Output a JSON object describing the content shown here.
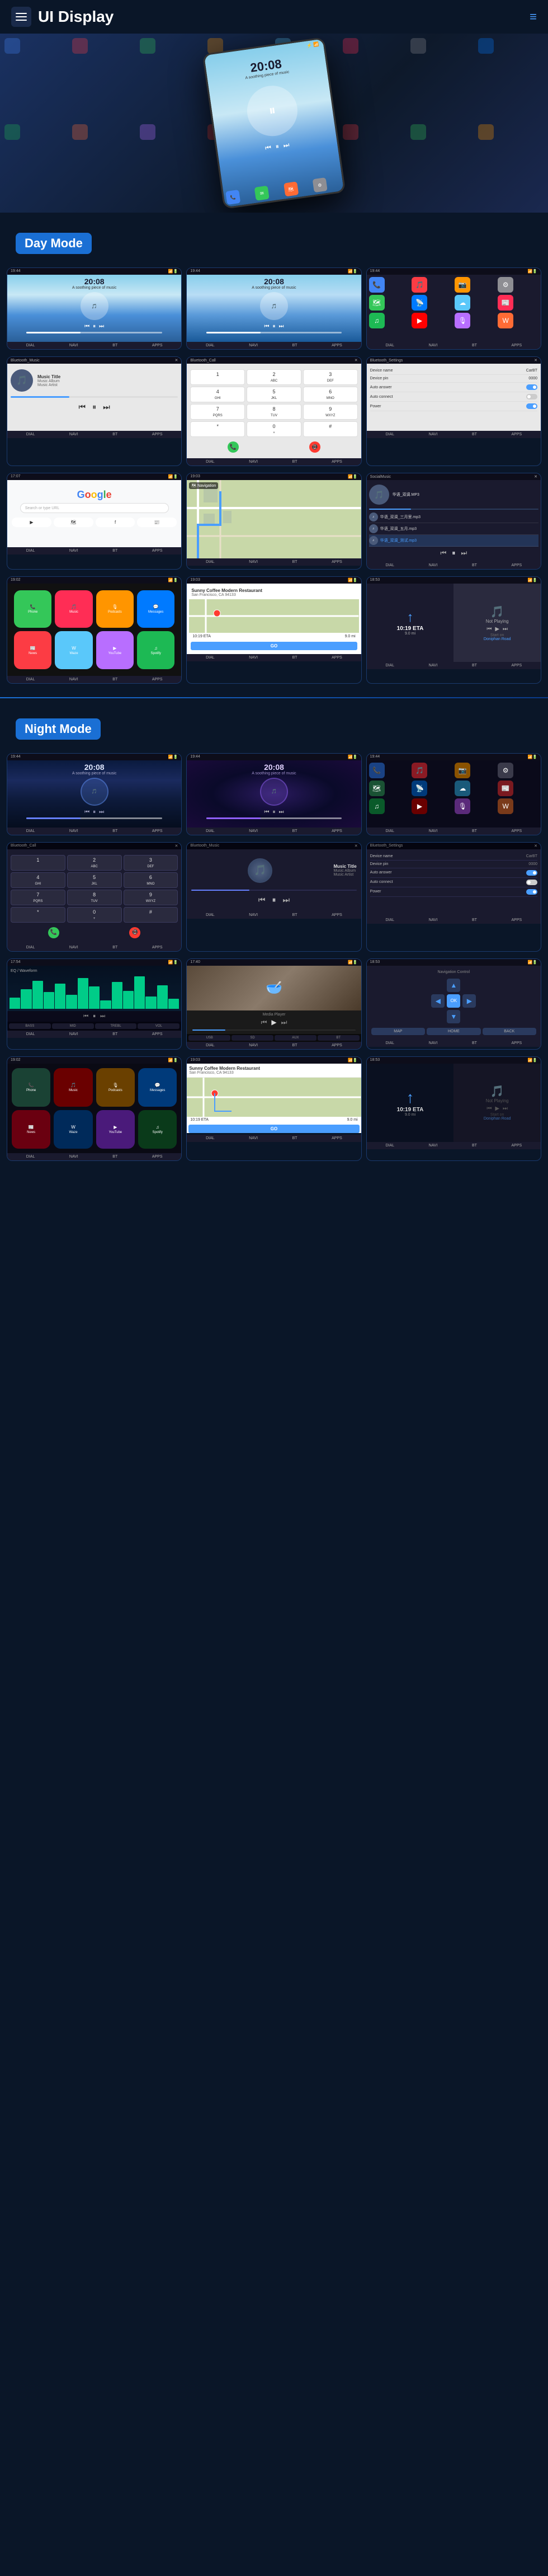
{
  "header": {
    "title": "UI Display",
    "menu_icon": "☰",
    "dots_icon": "⋮"
  },
  "day_mode": {
    "label": "Day Mode",
    "screens": {
      "music1": {
        "time": "20:08",
        "subtitle": "A soothing piece of music",
        "track_info": "Music Title"
      },
      "music2": {
        "time": "20:08",
        "subtitle": "A soothing piece of music"
      },
      "status_items": [
        "DIAL",
        "NAVI",
        "BT",
        "APPS"
      ],
      "bluetooth_music_title": "Bluetooth_Music",
      "music_title": "Music Title",
      "music_album": "Music Album",
      "music_artist": "Music Artist",
      "bluetooth_call_title": "Bluetooth_Call",
      "bluetooth_settings_title": "Bluetooth_Settings",
      "device_name_label": "Device name",
      "device_name_value": "CarBT",
      "device_pin_label": "Device pin",
      "device_pin_value": "0000",
      "auto_answer_label": "Auto answer",
      "auto_connect_label": "Auto connect",
      "power_label": "Power"
    }
  },
  "night_mode": {
    "label": "Night Mode",
    "music_title": "Music Title",
    "music_album": "Music Album",
    "music_artist": "Music Artist",
    "bluetooth_call_title": "Bluetooth_Call",
    "bluetooth_music_title": "Bluetooth_Music"
  },
  "nav_items": {
    "numpad": [
      "1",
      "2→",
      "3",
      "4→",
      "5→",
      "6→",
      "0→",
      "8→",
      "9→",
      "7→"
    ],
    "numpad_display": [
      {
        "label": "1",
        "sub": ""
      },
      {
        "label": "2",
        "sub": "ABC"
      },
      {
        "label": "3",
        "sub": "DEF"
      },
      {
        "label": "4",
        "sub": "GHI"
      },
      {
        "label": "5",
        "sub": "JKL"
      },
      {
        "label": "6",
        "sub": "MNO"
      },
      {
        "label": "7",
        "sub": "PQRS"
      },
      {
        "label": "8",
        "sub": "TUV"
      },
      {
        "label": "9",
        "sub": "WXYZ"
      },
      {
        "label": "*",
        "sub": ""
      },
      {
        "label": "0",
        "sub": "+"
      },
      {
        "label": "#",
        "sub": ""
      }
    ]
  },
  "restaurant": {
    "name": "Sunny Coffee Modern Restaurant",
    "address": "San Francisco, CA 94133",
    "eta": "10:19 ETA",
    "distance": "9.0 mi",
    "go_label": "GO"
  },
  "not_playing": {
    "label": "Not Playing"
  },
  "navigation": {
    "start_on": "Start on",
    "road_name": "Doniphan Road",
    "eta_value": "10:19 ETA",
    "distance": "9.0 mi"
  },
  "icons": {
    "play": "▶",
    "pause": "⏸",
    "prev": "⏮",
    "next": "⏭",
    "search": "🔍",
    "up": "▲",
    "down": "▼",
    "left": "◀",
    "right": "▶",
    "ok": "OK",
    "home": "⌂",
    "back": "←",
    "menu": "≡"
  },
  "app_colors": {
    "phone": "#34c759",
    "messages": "#32ade6",
    "maps": "#ff6b35",
    "music": "#fc3c44",
    "settings": "#8e8e93",
    "waze": "#0099ff",
    "youtube": "#ff0000",
    "spotify": "#1db954",
    "podcasts": "#b86eff",
    "news": "#ff3a30"
  }
}
